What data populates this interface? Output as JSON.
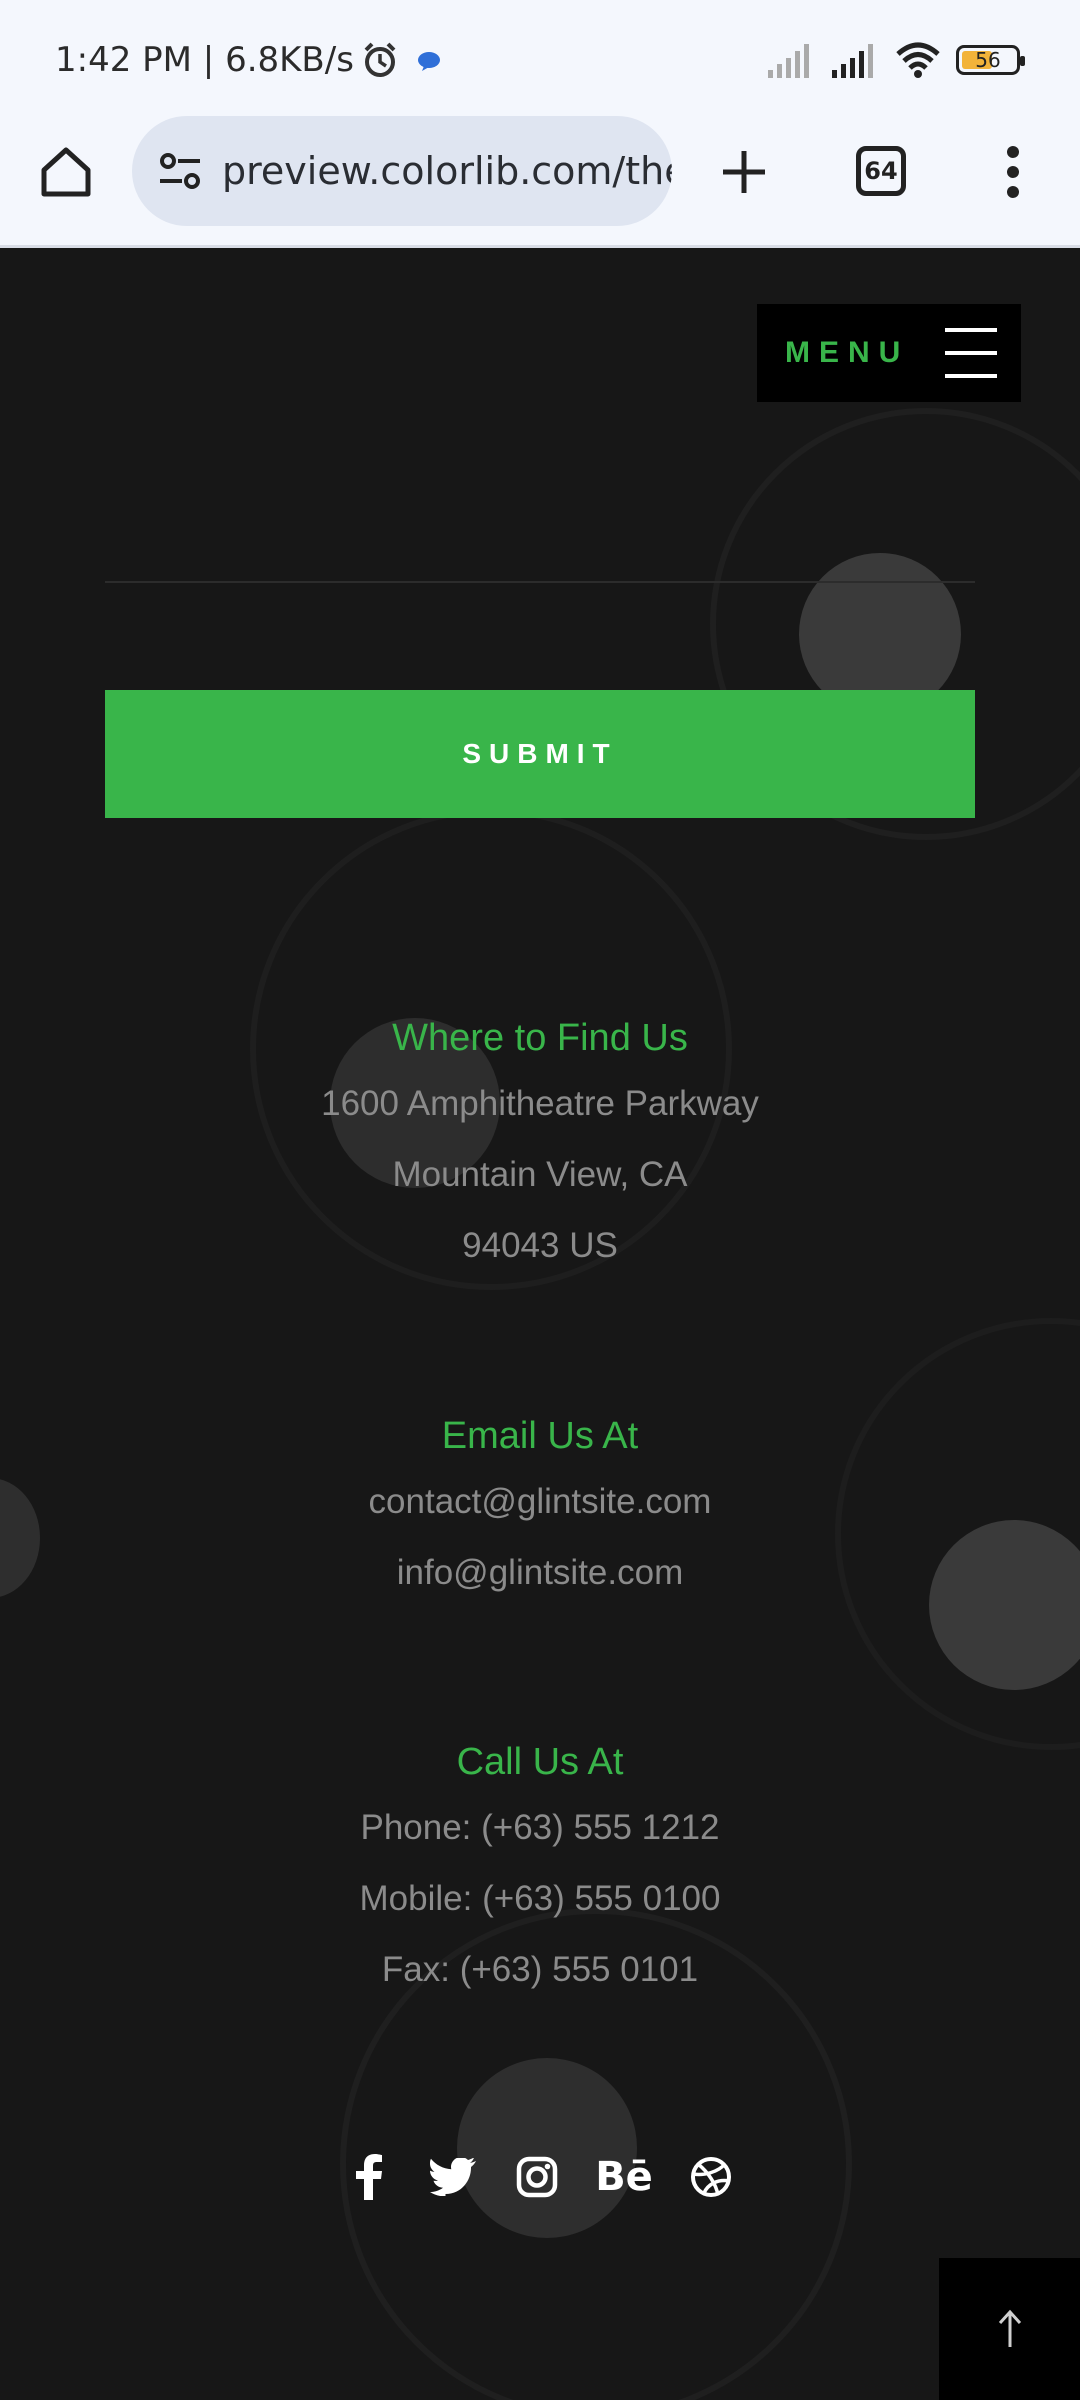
{
  "status_bar": {
    "time": "1:42 PM | 6.8KB/s",
    "battery": "56",
    "icons": [
      "alarm-icon",
      "notification-dot-icon",
      "signal-icon",
      "signal-icon",
      "wifi-icon",
      "battery-icon"
    ]
  },
  "browser": {
    "url": "preview.colorlib.com/ther",
    "tab_count": "64"
  },
  "nav": {
    "menu_label": "MENU"
  },
  "form": {
    "submit_label": "SUBMIT"
  },
  "find_us": {
    "title": "Where to Find Us",
    "lines": [
      "1600 Amphitheatre Parkway",
      "Mountain View, CA",
      "94043 US"
    ]
  },
  "email": {
    "title": "Email Us At",
    "lines": [
      "contact@glintsite.com",
      "info@glintsite.com"
    ]
  },
  "call": {
    "title": "Call Us At",
    "lines": [
      "Phone: (+63) 555 1212",
      "Mobile: (+63) 555 0100",
      "Fax: (+63) 555 0101"
    ]
  },
  "social": {
    "icons": [
      "facebook-icon",
      "twitter-icon",
      "instagram-icon",
      "behance-icon",
      "dribbble-icon"
    ],
    "behance_text": "Bē"
  },
  "colors": {
    "accent": "#39b54a",
    "background": "#171717",
    "text_muted": "#8b8b8b"
  }
}
